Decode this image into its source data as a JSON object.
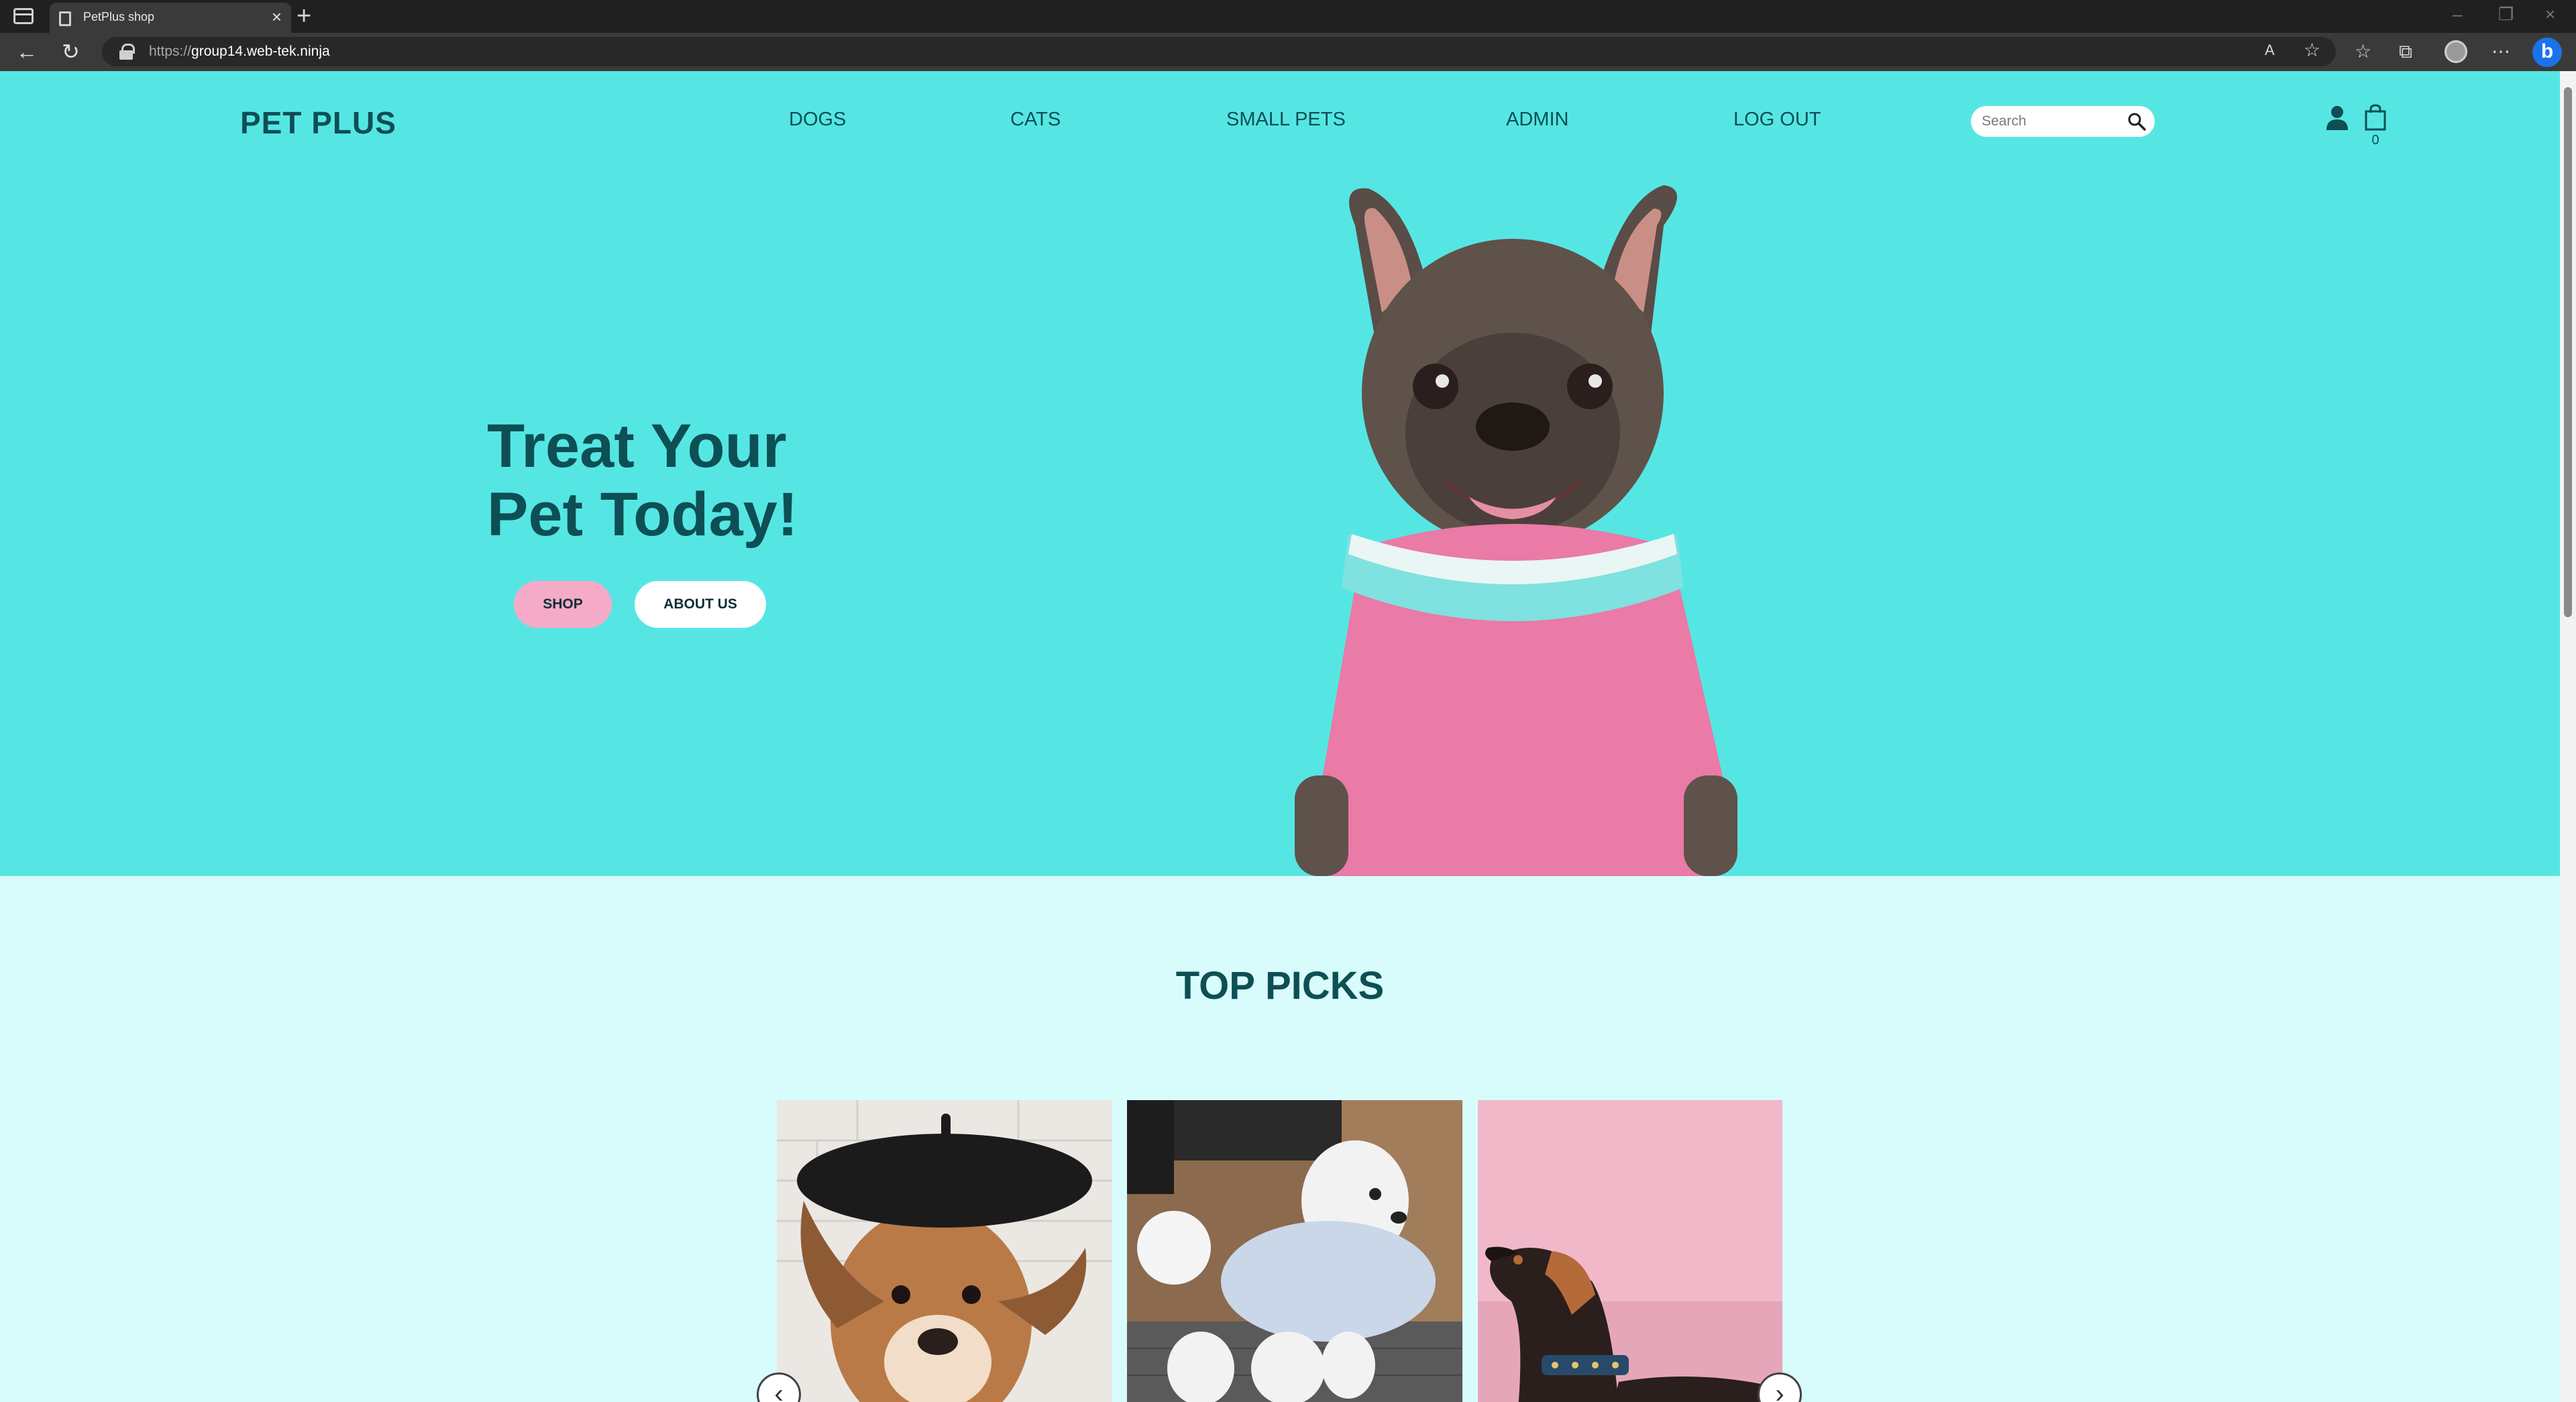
{
  "browser": {
    "tab_title": "PetPlus shop",
    "url_scheme": "https://",
    "url_host": "group14.web-tek.ninja"
  },
  "site": {
    "logo": "PET PLUS",
    "nav": [
      "DOGS",
      "CATS",
      "SMALL PETS",
      "ADMIN",
      "LOG OUT"
    ],
    "search_placeholder": "Search",
    "cart_count": "0"
  },
  "hero": {
    "headline_line1": "Treat Your",
    "headline_line2": "Pet Today!",
    "shop_label": "SHOP",
    "about_label": "ABOUT US",
    "background_color": "#55e6e4"
  },
  "top_picks": {
    "title": "TOP PICKS"
  },
  "colors": {
    "brand_dark": "#0d4f54",
    "shop_button": "#f5aac8",
    "page_bg": "#d8fcfb"
  }
}
